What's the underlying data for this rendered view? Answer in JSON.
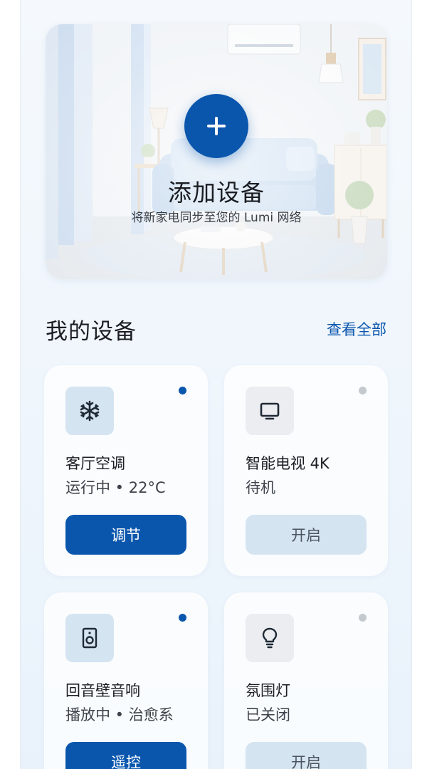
{
  "hero": {
    "title": "添加设备",
    "subtitle": "将新家电同步至您的 Lumi 网络",
    "add_icon": "plus-icon"
  },
  "section": {
    "title": "我的设备",
    "view_all": "查看全部"
  },
  "devices": [
    {
      "name": "客厅空调",
      "status": "运行中 • 22°C",
      "action": "调节",
      "icon": "snowflake-icon",
      "active": true
    },
    {
      "name": "智能电视 4K",
      "status": "待机",
      "action": "开启",
      "icon": "tv-icon",
      "active": false
    },
    {
      "name": "回音壁音响",
      "status": "播放中 • 治愈系",
      "action": "遥控",
      "icon": "speaker-icon",
      "active": true
    },
    {
      "name": "氛围灯",
      "status": "已关闭",
      "action": "开启",
      "icon": "lightbulb-icon",
      "active": false
    }
  ],
  "colors": {
    "accent": "#0a56ad",
    "active_dot": "#0a56ad",
    "inactive_dot": "#c4c8cf",
    "secondary_button": "#d5e4f1"
  }
}
